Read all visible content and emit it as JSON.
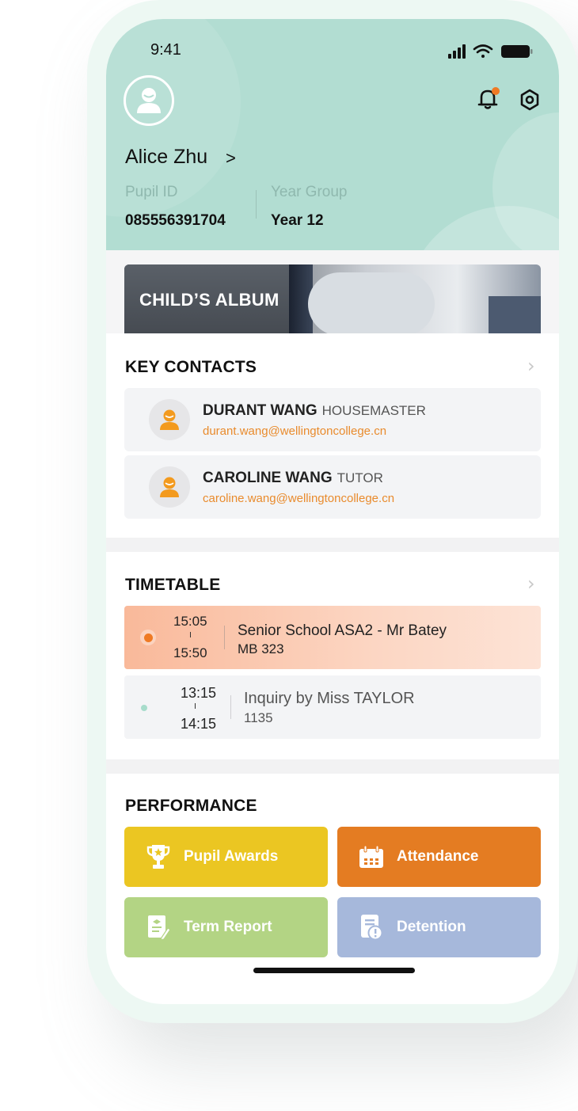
{
  "status_bar": {
    "time": "9:41",
    "signal_icon": "cellular-signal-icon",
    "wifi_icon": "wifi-icon",
    "battery_icon": "battery-icon"
  },
  "header": {
    "bg_color": "#b2ddd2",
    "name": "Alice Zhu",
    "name_chevron": ">",
    "pupil_id_label": "Pupil ID",
    "pupil_id": "085556391704",
    "year_group_label": "Year Group",
    "year_group": "Year 12",
    "notification_icon": "bell-icon",
    "settings_icon": "gear-icon",
    "has_notification": true
  },
  "album": {
    "title": "CHILD’S ALBUM"
  },
  "key_contacts": {
    "title": "KEY CONTACTS",
    "contacts": [
      {
        "name": "DURANT WANG",
        "role": "HOUSEMASTER",
        "email": "durant.wang@wellingtoncollege.cn"
      },
      {
        "name": "CAROLINE WANG",
        "role": "TUTOR",
        "email": "caroline.wang@wellingtoncollege.cn"
      }
    ]
  },
  "timetable": {
    "title": "TIMETABLE",
    "items": [
      {
        "start": "15:05",
        "end": "15:50",
        "title": "Senior School ASA2 - Mr Batey",
        "room": "MB 323",
        "active": true
      },
      {
        "start": "13:15",
        "end": "14:15",
        "title": "Inquiry by Miss TAYLOR",
        "room": "1135",
        "active": false
      }
    ]
  },
  "performance": {
    "title": "PERFORMANCE",
    "buttons": [
      {
        "label": "Pupil Awards",
        "icon": "trophy-icon",
        "color": "#ebc622"
      },
      {
        "label": "Attendance",
        "icon": "calendar-icon",
        "color": "#e47c22"
      },
      {
        "label": "Term Report",
        "icon": "report-icon",
        "color": "#b3d484"
      },
      {
        "label": "Detention",
        "icon": "detention-notice-icon",
        "color": "#a6b8db"
      }
    ]
  },
  "colors": {
    "accent_orange": "#ef7a24",
    "email_orange": "#e98b2d"
  }
}
